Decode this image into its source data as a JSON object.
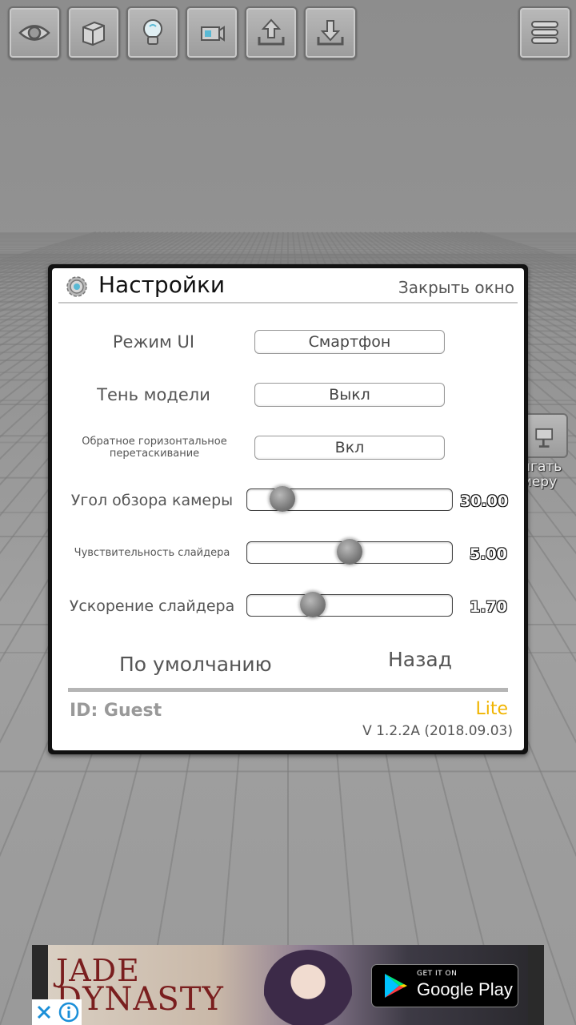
{
  "toolbar": {
    "items": [
      {
        "name": "eye-icon"
      },
      {
        "name": "cube-icon"
      },
      {
        "name": "lightbulb-icon"
      },
      {
        "name": "camera-move-icon"
      },
      {
        "name": "upload-icon"
      },
      {
        "name": "download-icon"
      }
    ],
    "menu_icon": "menu-icon"
  },
  "side_tool": {
    "label": "игать\nмеру"
  },
  "dialog": {
    "title": "Настройки",
    "close_label": "Закрыть окно",
    "settings": [
      {
        "label": "Режим UI",
        "value": "Смартфон"
      },
      {
        "label": "Тень модели",
        "value": "Выкл"
      },
      {
        "label": "Обратное горизонтальное перетаскивание",
        "value": "Вкл"
      }
    ],
    "sliders": [
      {
        "label": "Угол обзора камеры",
        "value": "30.00",
        "position": 0.17
      },
      {
        "label": "Чувствительность слайдера",
        "value": "5.00",
        "position": 0.5
      },
      {
        "label": "Ускорение слайдера",
        "value": "1.70",
        "position": 0.32
      }
    ],
    "default_button": "По умолчанию",
    "back_button": "Назад",
    "user_id": "ID: Guest",
    "edition": "Lite",
    "version": "V 1.2.2A (2018.09.03)"
  },
  "ad": {
    "brand_line1": "JADE",
    "brand_line2": "DYNASTY",
    "badge_small": "GET IT ON",
    "badge_big": "Google Play"
  },
  "colors": {
    "accent_lite": "#f0b400",
    "background": "#8f8f8f"
  }
}
